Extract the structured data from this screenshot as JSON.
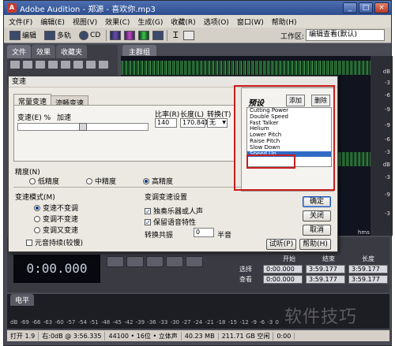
{
  "app": {
    "title": "Adobe Audition - 郑源 - 喜欢你.mp3",
    "logo_letter": "A",
    "win_min": "_",
    "win_max": "□",
    "win_close": "×"
  },
  "menu": [
    "文件(F)",
    "编辑(E)",
    "视图(V)",
    "效果(C)",
    "生成(G)",
    "收藏(R)",
    "选项(O)",
    "窗口(W)",
    "帮助(H)"
  ],
  "toolbar": {
    "edit": "编辑",
    "multitrack": "多轨",
    "cd": "CD",
    "workspace_label": "工作区:",
    "workspace_value": "编辑查看(默认)"
  },
  "panel_tabs": [
    "文件",
    "效果",
    "收藏夹"
  ],
  "editor_tab": "主群组",
  "db_scale": [
    "dB",
    "-3",
    "-6",
    "-9",
    "-9",
    "-6",
    "-3",
    "dB",
    "-3",
    "-9",
    "-3"
  ],
  "hms": "hms",
  "time_display": "0:00.000",
  "selection": {
    "headers": [
      "开始",
      "结束",
      "长度"
    ],
    "rows": [
      {
        "label": "选择",
        "start": "0:00.000",
        "end": "3:59.177",
        "length": "3:59.177"
      },
      {
        "label": "查看",
        "start": "0:00.000",
        "end": "3:59.177",
        "length": "3:59.177"
      }
    ]
  },
  "level": {
    "tab": "电平",
    "ticks": [
      "dB",
      "-69",
      "-66",
      "-63",
      "-60",
      "-57",
      "-54",
      "-51",
      "-48",
      "-45",
      "-42",
      "-39",
      "-36",
      "-33",
      "-30",
      "-27",
      "-24",
      "-21",
      "-18",
      "-15",
      "-12",
      "-9",
      "-6",
      "-3",
      "0"
    ]
  },
  "status": [
    "打开 1.9",
    "右:0dB @ 3:56.335",
    "44100 • 16位 • 立体声",
    "40.23 MB",
    "211.71 GB 空闲",
    "0:00"
  ],
  "dialog": {
    "title": "变速",
    "tab_constant": "常量变速",
    "tab_gliding": "流畅变速",
    "label_rate": "变速(E) %",
    "label_accel": "加速",
    "slider_value": 0.5,
    "label_ratio": "比率(R)",
    "label_length": "长度(L)",
    "label_convert": "转换(T)",
    "ratio": "140",
    "length": "170.841",
    "convert": "无",
    "precision_label": "精度(N)",
    "precision_low": "低精度",
    "precision_mid": "中精度",
    "precision_high": "高精度",
    "mode_label": "变速模式(M)",
    "mode_1": "变速不变调",
    "mode_2": "变调不变速",
    "mode_3": "变调又变速",
    "formant": "元音持续(较慢)",
    "pitch_settings_label": "变调变速设置",
    "pitch_chk1": "独奏乐器或人声",
    "pitch_chk2": "保留语音特性",
    "transpose_label": "转换共振",
    "transpose_value": "0",
    "semitone": "半音",
    "preset_title": "预设",
    "preset_add": "添加",
    "preset_del": "删除",
    "presets": [
      "Cutting Power",
      "Double Speed",
      "Fast Talker",
      "Helium",
      "Lower Pitch",
      "Raise Pitch",
      "Slow Down",
      "Speed Up"
    ],
    "preset_selected": 7,
    "btn_ok": "确定",
    "btn_close": "关闭",
    "btn_cancel": "取消",
    "btn_preview": "试听(P)",
    "btn_help": "帮助(H)"
  },
  "watermark": "软件技巧",
  "colors": {
    "highlight": "#c81e1e",
    "selection": "#316ac5"
  }
}
